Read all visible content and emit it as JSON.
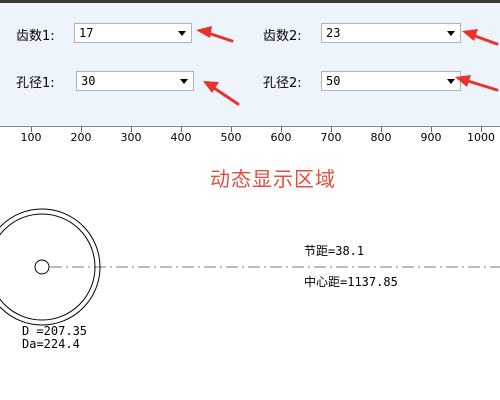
{
  "controls": {
    "teeth1": {
      "label": "齿数1:",
      "value": "17"
    },
    "teeth2": {
      "label": "齿数2:",
      "value": "23"
    },
    "bore1": {
      "label": "孔径1:",
      "value": "30"
    },
    "bore2": {
      "label": "孔径2:",
      "value": "50"
    }
  },
  "ruler": {
    "ticks": [
      "100",
      "200",
      "300",
      "400",
      "500",
      "600",
      "700",
      "800",
      "900",
      "1000"
    ]
  },
  "display": {
    "title": "动态显示区域",
    "pitch": "节距=38.1",
    "center_distance": "中心距=1137.85",
    "d_value": "D =207.35",
    "da_value": "Da=224.4"
  },
  "colors": {
    "panel_bg": "#eef4fc",
    "title_red": "#e84b3c",
    "arrow_red": "#e8322a"
  }
}
